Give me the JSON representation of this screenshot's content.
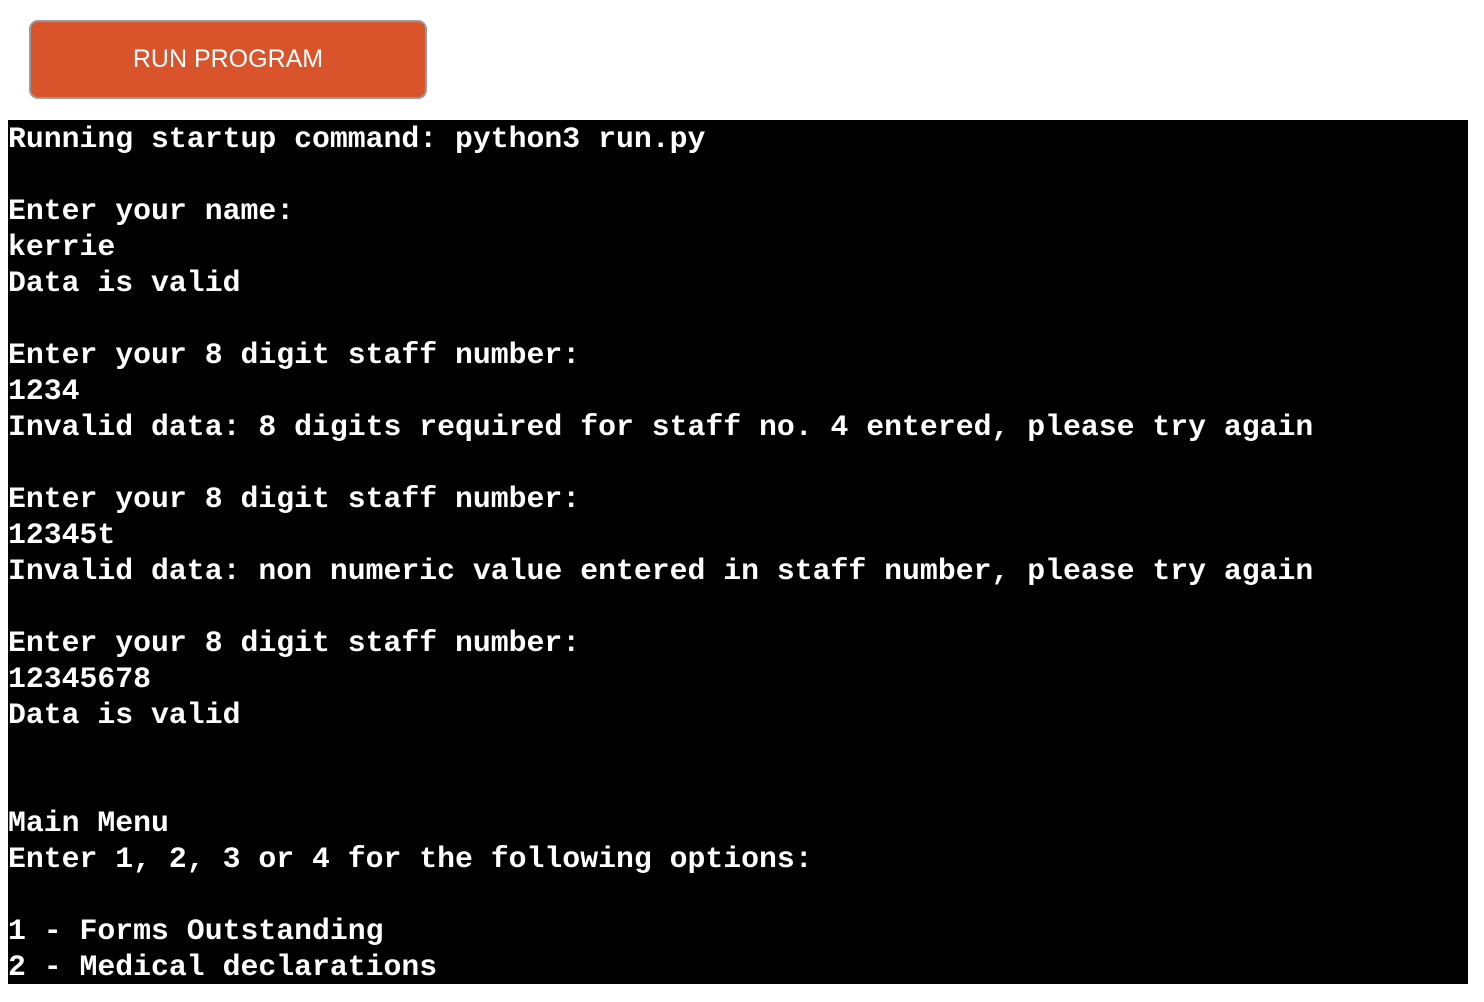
{
  "toolbar": {
    "run_label": "RUN PROGRAM"
  },
  "colors": {
    "run_button_bg": "#d9542b",
    "terminal_bg": "#000000",
    "terminal_text": "#ffffff"
  },
  "terminal": {
    "lines": [
      "Running startup command: python3 run.py",
      "",
      "Enter your name:",
      "kerrie",
      "Data is valid",
      "",
      "Enter your 8 digit staff number:",
      "1234",
      "Invalid data: 8 digits required for staff no. 4 entered, please try again",
      "",
      "Enter your 8 digit staff number:",
      "12345t",
      "Invalid data: non numeric value entered in staff number, please try again",
      "",
      "Enter your 8 digit staff number:",
      "12345678",
      "Data is valid",
      "",
      "",
      "Main Menu",
      "Enter 1, 2, 3 or 4 for the following options:",
      "",
      "1 - Forms Outstanding",
      "2 - Medical declarations"
    ]
  }
}
